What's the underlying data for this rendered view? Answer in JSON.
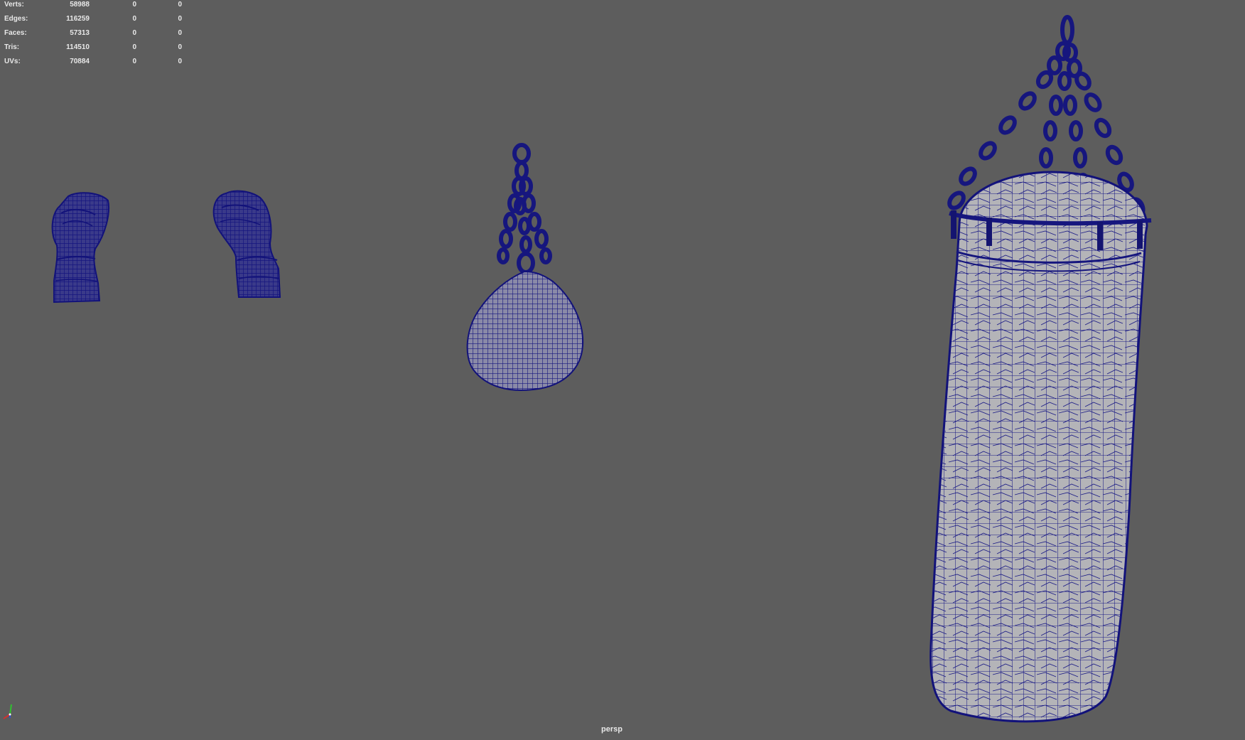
{
  "stats": {
    "rows": [
      {
        "label": "Verts:",
        "value": "58988",
        "selected": "0",
        "component": "0"
      },
      {
        "label": "Edges:",
        "value": "116259",
        "selected": "0",
        "component": "0"
      },
      {
        "label": "Faces:",
        "value": "57313",
        "selected": "0",
        "component": "0"
      },
      {
        "label": "Tris:",
        "value": "114510",
        "selected": "0",
        "component": "0"
      },
      {
        "label": "UVs:",
        "value": "70884",
        "selected": "0",
        "component": "0"
      }
    ]
  },
  "viewport": {
    "camera_label": "persp",
    "background_color": "#5d5d5d",
    "wireframe_color": "#1a1a8c",
    "object_shade_color": "#a4a4a8",
    "objects": [
      "boxing-glove-left",
      "boxing-glove-right",
      "speed-bag",
      "heavy-punching-bag"
    ]
  },
  "axis_gizmo": {
    "x_color": "#d03030",
    "y_color": "#30c030",
    "z_color": "#3050d0"
  }
}
